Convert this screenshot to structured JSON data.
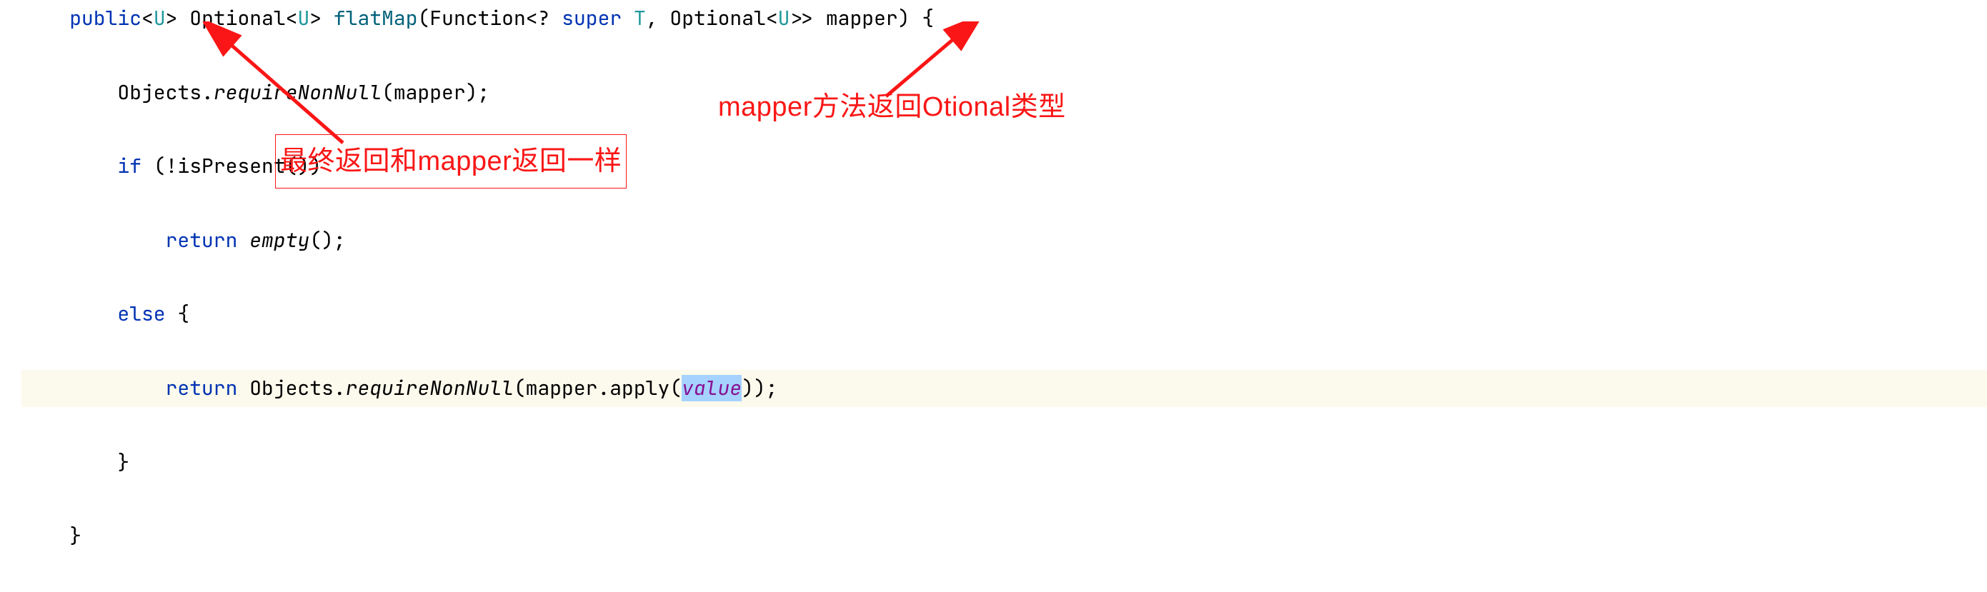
{
  "code": {
    "line1": {
      "public": "public",
      "lt1": "<",
      "u1": "U",
      "gt1": ">",
      "sp1": " ",
      "optional1": "Optional",
      "lt2": "<",
      "u2": "U",
      "gt2": ">",
      "sp2": " ",
      "flatmap": "flatMap",
      "open": "(",
      "function": "Function",
      "lt3": "<",
      "wild": "? ",
      "super": "super",
      "sp3": " ",
      "t": "T",
      "comma": ", ",
      "optional2": "Optional",
      "lt4": "<",
      "u3": "U",
      "gt4": ">>",
      "sp4": " ",
      "mapper": "mapper",
      "close": ") {"
    },
    "line2": {
      "indent": "        ",
      "objects": "Objects.",
      "require": "requireNonNull",
      "args": "(mapper);"
    },
    "line3": {
      "indent": "        ",
      "if": "if",
      "cond": " (!isPresent())"
    },
    "line4": {
      "indent": "            ",
      "return": "return",
      "sp": " ",
      "empty": "empty",
      "end": "();"
    },
    "line5": {
      "indent": "        ",
      "else": "else",
      "brace": " {"
    },
    "line6": {
      "indent": "            ",
      "return": "return",
      "sp": " ",
      "objects": "Objects.",
      "require": "requireNonNull",
      "open": "(mapper.apply(",
      "value": "value",
      "close": "));"
    },
    "line7": {
      "indent": "        ",
      "brace": "}"
    },
    "line8": {
      "indent": "    ",
      "brace": "}"
    }
  },
  "annotations": {
    "left": "最终返回和mapper返回一样",
    "right": "mapper方法返回Otional类型"
  }
}
